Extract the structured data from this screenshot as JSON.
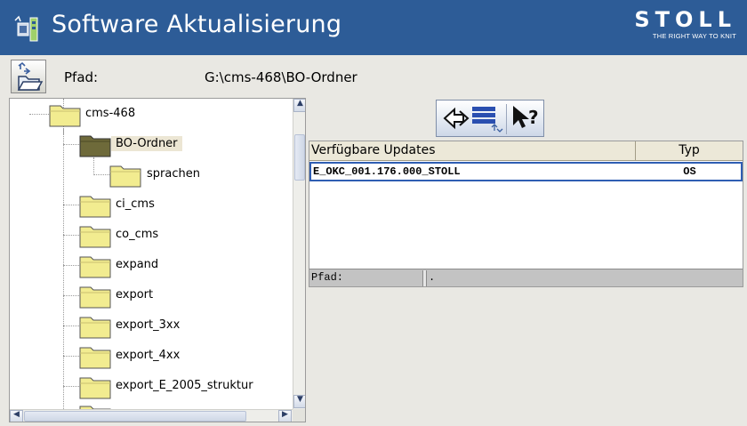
{
  "window": {
    "title": "Software Aktualisierung"
  },
  "brand": {
    "name": "STOLL",
    "tagline": "THE RIGHT WAY TO KNIT"
  },
  "path_row": {
    "label": "Pfad:",
    "value": "G:\\cms-468\\BO-Ordner"
  },
  "tree": {
    "items": [
      {
        "label": "cms-468",
        "selected": false,
        "open": false
      },
      {
        "label": "BO-Ordner",
        "selected": true,
        "open": true
      },
      {
        "label": "sprachen",
        "selected": false,
        "open": false
      },
      {
        "label": "ci_cms",
        "selected": false,
        "open": false
      },
      {
        "label": "co_cms",
        "selected": false,
        "open": false
      },
      {
        "label": "expand",
        "selected": false,
        "open": false
      },
      {
        "label": "export",
        "selected": false,
        "open": false
      },
      {
        "label": "export_3xx",
        "selected": false,
        "open": false
      },
      {
        "label": "export_4xx",
        "selected": false,
        "open": false
      },
      {
        "label": "export_E_2005_struktur",
        "selected": false,
        "open": false
      }
    ]
  },
  "updates": {
    "columns": [
      "Verfügbare Updates",
      "Typ"
    ],
    "rows": [
      {
        "name": "E_OKC_001.176.000_STOLL",
        "type": "OS"
      }
    ],
    "footer": {
      "label": "Pfad:",
      "value": "."
    }
  },
  "colors": {
    "titlebar": "#2d5c97",
    "selection_border": "#2f5eb3",
    "folder": "#f2ec90",
    "folder_open": "#6e6a3a"
  }
}
